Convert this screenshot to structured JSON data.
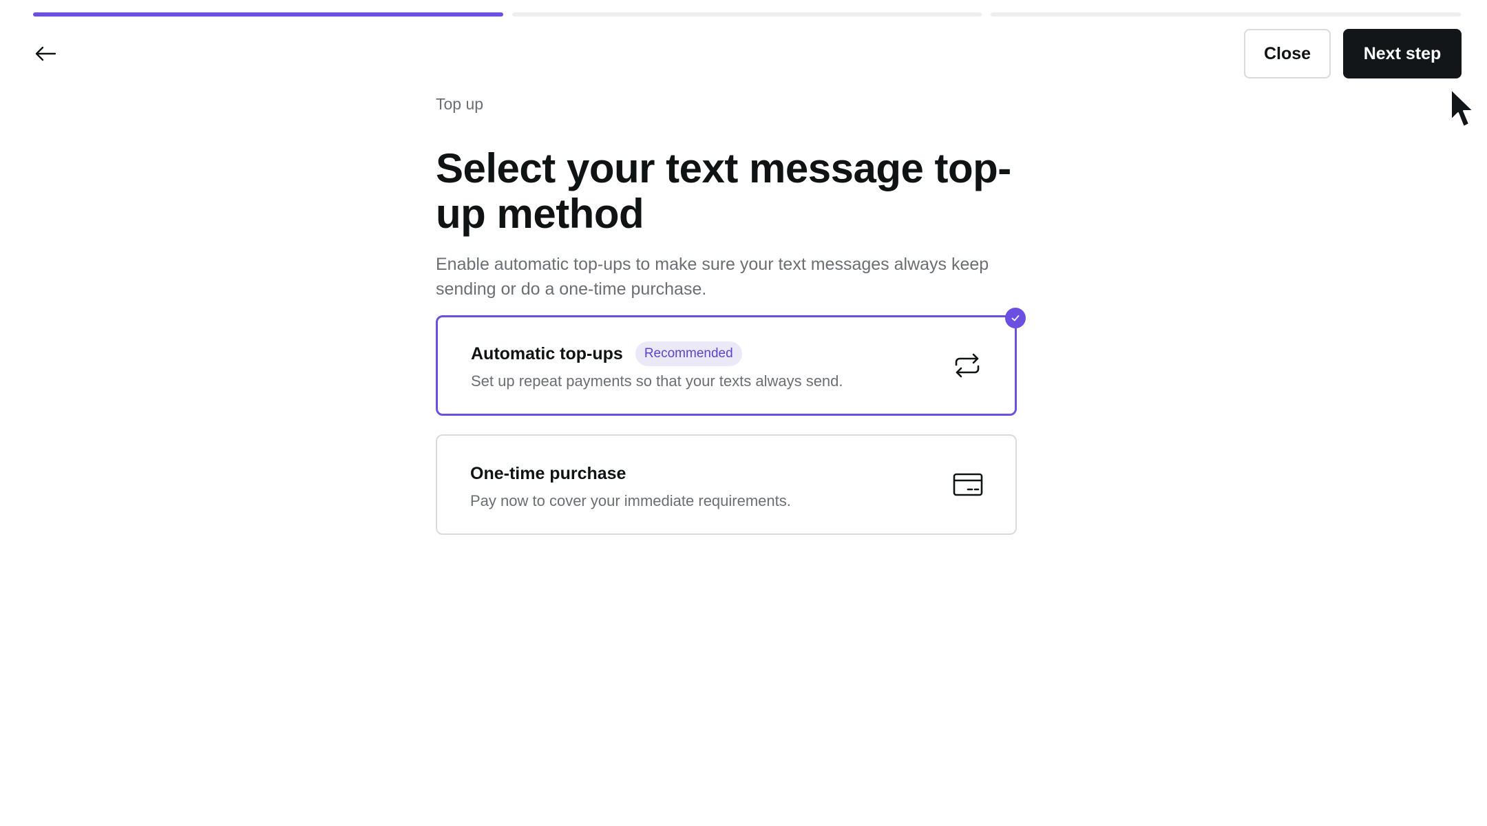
{
  "progress": {
    "steps_total": 3,
    "current_step": 1
  },
  "header": {
    "back_icon": "arrow-left-icon",
    "close_label": "Close",
    "next_label": "Next step"
  },
  "main": {
    "eyebrow": "Top up",
    "title": "Select your text message top-up method",
    "description": "Enable automatic top-ups to make sure your text messages always keep sending or do a one-time purchase."
  },
  "options": [
    {
      "title": "Automatic top-ups",
      "badge": "Recommended",
      "description": "Set up repeat payments so that your texts always send.",
      "icon": "repeat-icon",
      "selected": true
    },
    {
      "title": "One-time purchase",
      "description": "Pay now to cover your immediate requirements.",
      "icon": "credit-card-icon",
      "selected": false
    }
  ],
  "colors": {
    "accent": "#6b4fe0",
    "primary_button": "#121619",
    "text_primary": "#0f1314",
    "text_secondary": "#6b6e72",
    "border": "#d9dadc",
    "badge_bg": "#ebe9f7"
  }
}
